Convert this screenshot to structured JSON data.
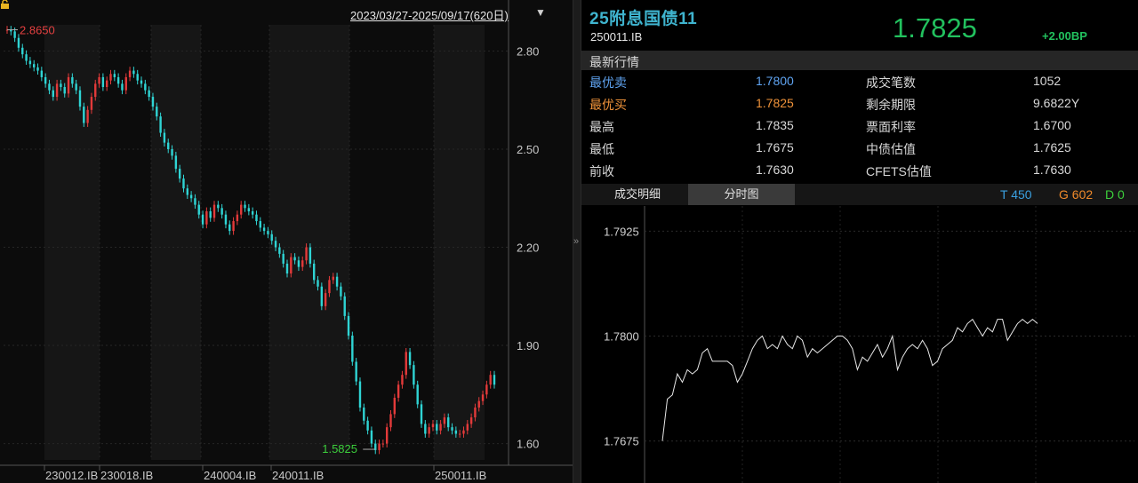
{
  "header": {
    "date_range": "2023/03/27-2025/09/17(620日)"
  },
  "chart_data": [
    {
      "type": "line",
      "name": "daily-yield",
      "x_start": "2023/03/27",
      "x_end": "2025/09/17",
      "y": [
        2.865,
        2.86,
        2.84,
        2.81,
        2.79,
        2.77,
        2.76,
        2.75,
        2.74,
        2.72,
        2.7,
        2.68,
        2.66,
        2.7,
        2.69,
        2.67,
        2.72,
        2.7,
        2.68,
        2.63,
        2.58,
        2.62,
        2.66,
        2.7,
        2.72,
        2.69,
        2.71,
        2.73,
        2.72,
        2.7,
        2.68,
        2.72,
        2.74,
        2.73,
        2.71,
        2.7,
        2.68,
        2.66,
        2.63,
        2.6,
        2.55,
        2.52,
        2.5,
        2.48,
        2.44,
        2.41,
        2.38,
        2.36,
        2.35,
        2.33,
        2.3,
        2.27,
        2.31,
        2.29,
        2.33,
        2.32,
        2.3,
        2.27,
        2.25,
        2.28,
        2.3,
        2.33,
        2.32,
        2.31,
        2.3,
        2.28,
        2.26,
        2.25,
        2.24,
        2.22,
        2.2,
        2.18,
        2.15,
        2.12,
        2.17,
        2.16,
        2.14,
        2.16,
        2.2,
        2.15,
        2.1,
        2.08,
        2.02,
        2.06,
        2.1,
        2.11,
        2.08,
        2.05,
        1.99,
        1.93,
        1.85,
        1.79,
        1.71,
        1.67,
        1.64,
        1.6,
        1.58,
        1.6,
        1.6,
        1.65,
        1.69,
        1.74,
        1.78,
        1.81,
        1.88,
        1.84,
        1.78,
        1.72,
        1.66,
        1.63,
        1.65,
        1.66,
        1.64,
        1.66,
        1.68,
        1.65,
        1.64,
        1.63,
        1.63,
        1.64,
        1.66,
        1.68,
        1.71,
        1.73,
        1.75,
        1.78,
        1.81,
        1.78
      ],
      "y_high": 2.865,
      "y_low": 1.5825,
      "y_ticks": [
        "2.80",
        "2.50",
        "2.20",
        "1.90",
        "1.60"
      ],
      "ylim": [
        1.55,
        2.88
      ],
      "x_tick_labels": [
        "230012.IB",
        "230018.IB",
        "240004.IB",
        "240011.IB",
        "250011.IB"
      ],
      "colors": {
        "up": "#e33a3a",
        "down": "#2fd4d4",
        "high_label": "#e34040",
        "low_label": "#3ccf3c"
      }
    },
    {
      "type": "line",
      "name": "intraday",
      "y": [
        1.7675,
        1.7725,
        1.773,
        1.7755,
        1.7745,
        1.776,
        1.7755,
        1.776,
        1.778,
        1.7785,
        1.777,
        1.777,
        1.777,
        1.777,
        1.7765,
        1.7745,
        1.7755,
        1.777,
        1.7785,
        1.7795,
        1.78,
        1.7785,
        1.779,
        1.7785,
        1.78,
        1.779,
        1.7785,
        1.78,
        1.7795,
        1.7775,
        1.7785,
        1.778,
        1.7785,
        1.779,
        1.7795,
        1.78,
        1.78,
        1.7795,
        1.7785,
        1.776,
        1.7775,
        1.777,
        1.778,
        1.779,
        1.7775,
        1.7785,
        1.78,
        1.776,
        1.7775,
        1.7785,
        1.779,
        1.7785,
        1.7795,
        1.7785,
        1.7765,
        1.777,
        1.7785,
        1.779,
        1.7795,
        1.781,
        1.7805,
        1.7815,
        1.782,
        1.781,
        1.78,
        1.781,
        1.7805,
        1.782,
        1.782,
        1.7795,
        1.7805,
        1.7815,
        1.782,
        1.7815,
        1.782,
        1.7815
      ],
      "y_ticks": [
        "1.7925",
        "1.7800",
        "1.7675"
      ],
      "ylim": [
        1.7625,
        1.7955
      ],
      "line_color": "#e8e8e8"
    }
  ],
  "bond": {
    "name": "25附息国债11",
    "code": "250011.IB",
    "price": "1.7825",
    "change": "+2.00BP"
  },
  "quotes": {
    "section_title": "最新行情",
    "rows": [
      {
        "l1": "最优卖",
        "v1": "1.7800",
        "l2": "成交笔数",
        "v2": "1052"
      },
      {
        "l1": "最优买",
        "v1": "1.7825",
        "l2": "剩余期限",
        "v2": "9.6822Y"
      },
      {
        "l1": "最高",
        "v1": "1.7835",
        "l2": "票面利率",
        "v2": "1.6700"
      },
      {
        "l1": "最低",
        "v1": "1.7675",
        "l2": "中债估值",
        "v2": "1.7625"
      },
      {
        "l1": "前收",
        "v1": "1.7630",
        "l2": "CFETS估值",
        "v2": "1.7630"
      }
    ],
    "colors": {
      "sell": "#5fa3f0",
      "buy": "#f0933a"
    }
  },
  "tabs": [
    {
      "label": "成交明细",
      "active": false
    },
    {
      "label": "分时图",
      "active": true
    }
  ],
  "counters": {
    "t": "T 450",
    "g": "G 602",
    "d": "D 0",
    "colors": {
      "t": "#3aa0e0",
      "g": "#f08a2a",
      "d": "#3ccf3c"
    }
  }
}
